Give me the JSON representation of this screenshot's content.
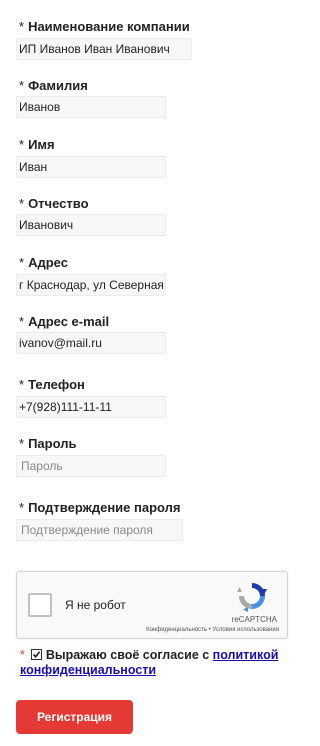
{
  "fields": [
    {
      "label": "Наименование компании",
      "required": "*",
      "value": "ИП Иванов Иван Иванович",
      "placeholder": ""
    },
    {
      "label": "Фамилия",
      "required": "*",
      "value": "Иванов",
      "placeholder": ""
    },
    {
      "label": "Имя",
      "required": "*",
      "value": "Иван",
      "placeholder": ""
    },
    {
      "label": "Отчество",
      "required": "*",
      "value": "Иванович",
      "placeholder": ""
    },
    {
      "label": "Адрес",
      "required": "*",
      "value": "г Краснодар, ул Северная",
      "placeholder": ""
    },
    {
      "label": "Адрес e-mail",
      "required": "*",
      "value": "ivanov@mail.ru",
      "placeholder": ""
    },
    {
      "label": "Телефон",
      "required": "*",
      "value": "+7(928)111-11-11",
      "placeholder": ""
    },
    {
      "label": "Пароль",
      "required": "*",
      "value": "",
      "placeholder": "Пароль"
    },
    {
      "label": "Подтверждение пароля",
      "required": "*",
      "value": "",
      "placeholder": "Подтверждение пароля"
    }
  ],
  "captcha": {
    "text": "Я не робот",
    "brand": "reCAPTCHA",
    "links": "Конфиденциальность • Условия использования",
    "icon": "recaptcha-logo-icon"
  },
  "consent": {
    "required": "*",
    "checked": true,
    "text": "Выражаю своё согласие с ",
    "link": "политикой конфиденциальности"
  },
  "submit": {
    "label": "Регистрация"
  },
  "colors": {
    "accent": "#e53935",
    "link": "#1a0dab",
    "input_bg": "#f7f7f7"
  }
}
